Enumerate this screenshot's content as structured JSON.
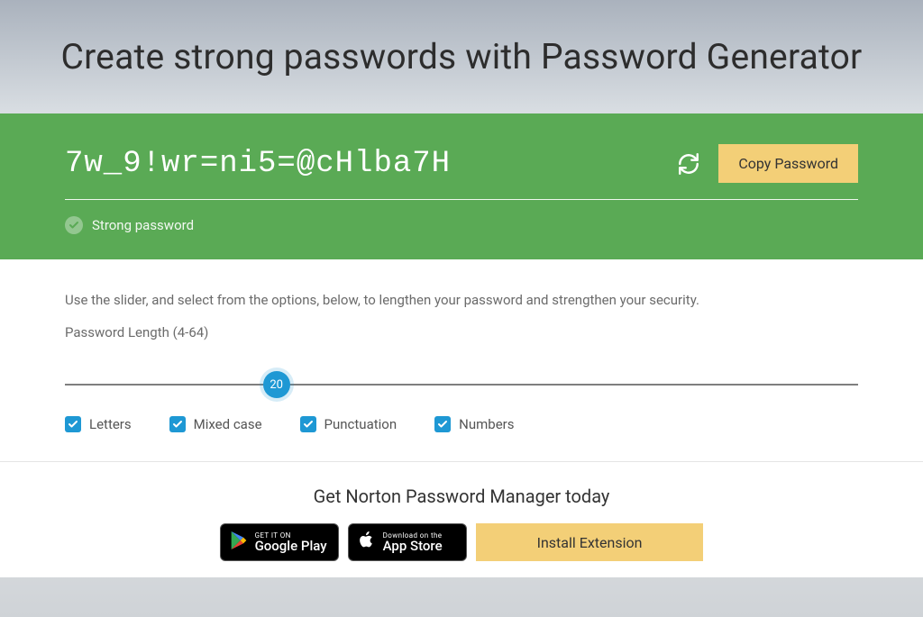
{
  "hero": {
    "title": "Create strong passwords with Password Generator"
  },
  "panel": {
    "password": "7w_9!wr=ni5=@cHlba7H",
    "copy_label": "Copy Password",
    "strength_label": "Strong password"
  },
  "options": {
    "instruction": "Use the slider, and select from the options, below, to lengthen your password and strengthen your security.",
    "length_label": "Password Length (4-64)",
    "slider": {
      "min": 4,
      "max": 64,
      "value": 20
    },
    "checks": [
      {
        "key": "letters",
        "label": "Letters",
        "checked": true
      },
      {
        "key": "mixed",
        "label": "Mixed case",
        "checked": true
      },
      {
        "key": "punct",
        "label": "Punctuation",
        "checked": true
      },
      {
        "key": "numbers",
        "label": "Numbers",
        "checked": true
      }
    ]
  },
  "promo": {
    "title": "Get Norton Password Manager today",
    "google": {
      "l1": "GET IT ON",
      "l2": "Google Play"
    },
    "apple": {
      "l1": "Download on the",
      "l2": "App Store"
    },
    "install_label": "Install Extension"
  },
  "colors": {
    "green_panel": "#5aaa55",
    "accent_blue": "#1e98d4",
    "button_amber": "#f3cf77"
  }
}
